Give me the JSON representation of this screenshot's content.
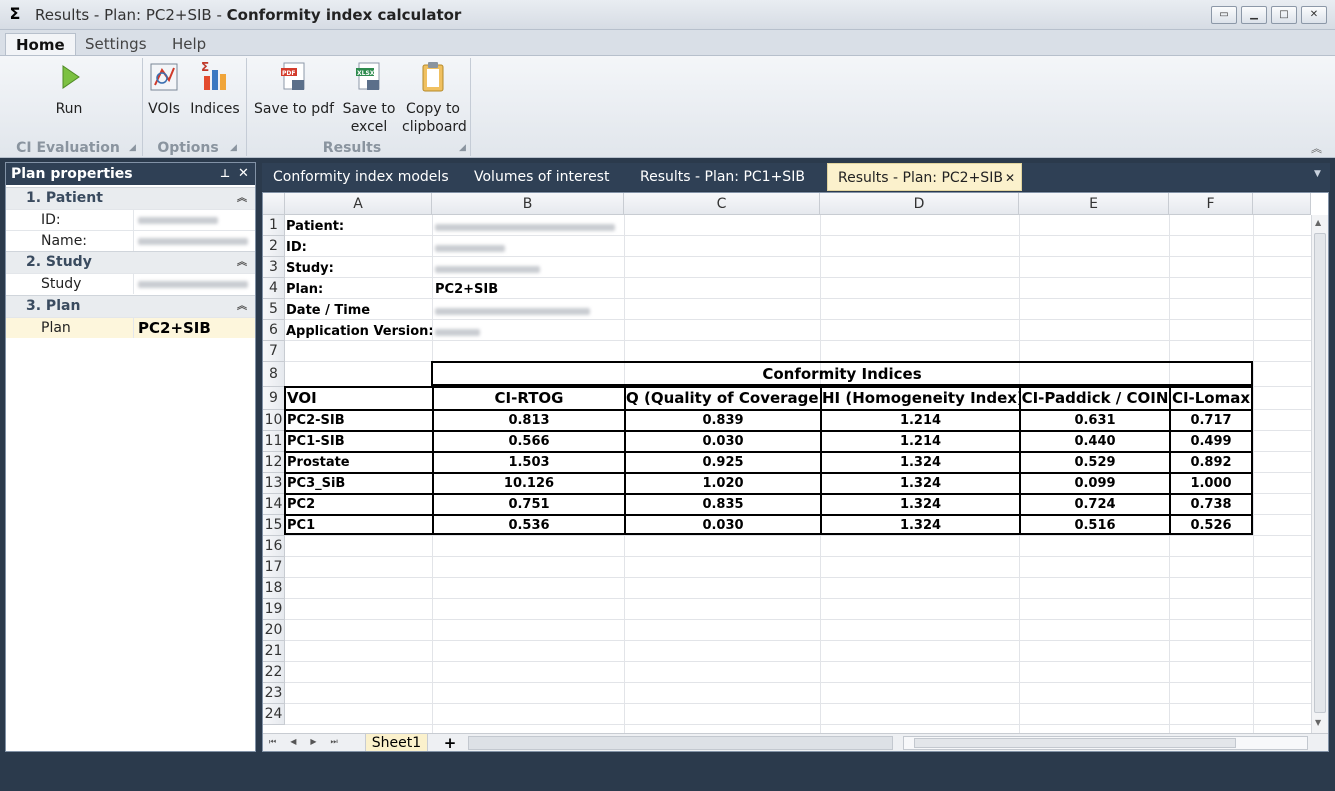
{
  "window": {
    "title_prefix": "Results - Plan: PC2+SIB - ",
    "title_app": "Conformity index calculator",
    "app_icon": "Σ"
  },
  "ribbon": {
    "tabs": [
      "Home",
      "Settings",
      "Help"
    ],
    "buttons": {
      "run": "Run",
      "vois": "VOIs",
      "indices": "Indices",
      "save_pdf": "Save to pdf",
      "save_excel_1": "Save to",
      "save_excel_2": "excel",
      "copy_1": "Copy to",
      "copy_2": "clipboard"
    },
    "groups": {
      "ci_evaluation": "CI Evaluation",
      "options": "Options",
      "results": "Results"
    }
  },
  "plan_properties": {
    "header": "Plan properties",
    "cat_patient": "1. Patient",
    "id_label": "ID:",
    "name_label": "Name:",
    "cat_study": "2. Study",
    "study_label": "Study",
    "cat_plan": "3. Plan",
    "plan_label": "Plan",
    "plan_value": "PC2+SIB"
  },
  "doc_tabs": [
    "Conformity index models",
    "Volumes of interest",
    "Results - Plan: PC1+SIB",
    "Results - Plan: PC2+SIB"
  ],
  "sheet": {
    "columns": [
      "A",
      "B",
      "C",
      "D",
      "E",
      "F"
    ],
    "rows": [
      "1",
      "2",
      "3",
      "4",
      "5",
      "6",
      "7",
      "8",
      "9",
      "10",
      "11",
      "12",
      "13",
      "14",
      "15",
      "16",
      "17",
      "18",
      "19",
      "20",
      "21",
      "22",
      "23",
      "24"
    ],
    "meta_labels": [
      "Patient:",
      "ID:",
      "Study:",
      "Plan:",
      "Date / Time",
      "Application Version:"
    ],
    "plan_value": "PC2+SIB",
    "group_title": "Conformity Indices",
    "headers": [
      "VOI",
      "CI-RTOG",
      "Q (Quality of Coverage)",
      "HI (Homogeneity Index)",
      "CI-Paddick / COIN",
      "CI-Lomax"
    ],
    "table": [
      [
        "PC2-SIB",
        "0.813",
        "0.839",
        "1.214",
        "0.631",
        "0.717"
      ],
      [
        "PC1-SIB",
        "0.566",
        "0.030",
        "1.214",
        "0.440",
        "0.499"
      ],
      [
        "Prostate",
        "1.503",
        "0.925",
        "1.324",
        "0.529",
        "0.892"
      ],
      [
        "PC3_SiB",
        "10.126",
        "1.020",
        "1.324",
        "0.099",
        "1.000"
      ],
      [
        "PC2",
        "0.751",
        "0.835",
        "1.324",
        "0.724",
        "0.738"
      ],
      [
        "PC1",
        "0.536",
        "0.030",
        "1.324",
        "0.516",
        "0.526"
      ]
    ],
    "sheet_tab": "Sheet1",
    "add_tab": "+"
  }
}
